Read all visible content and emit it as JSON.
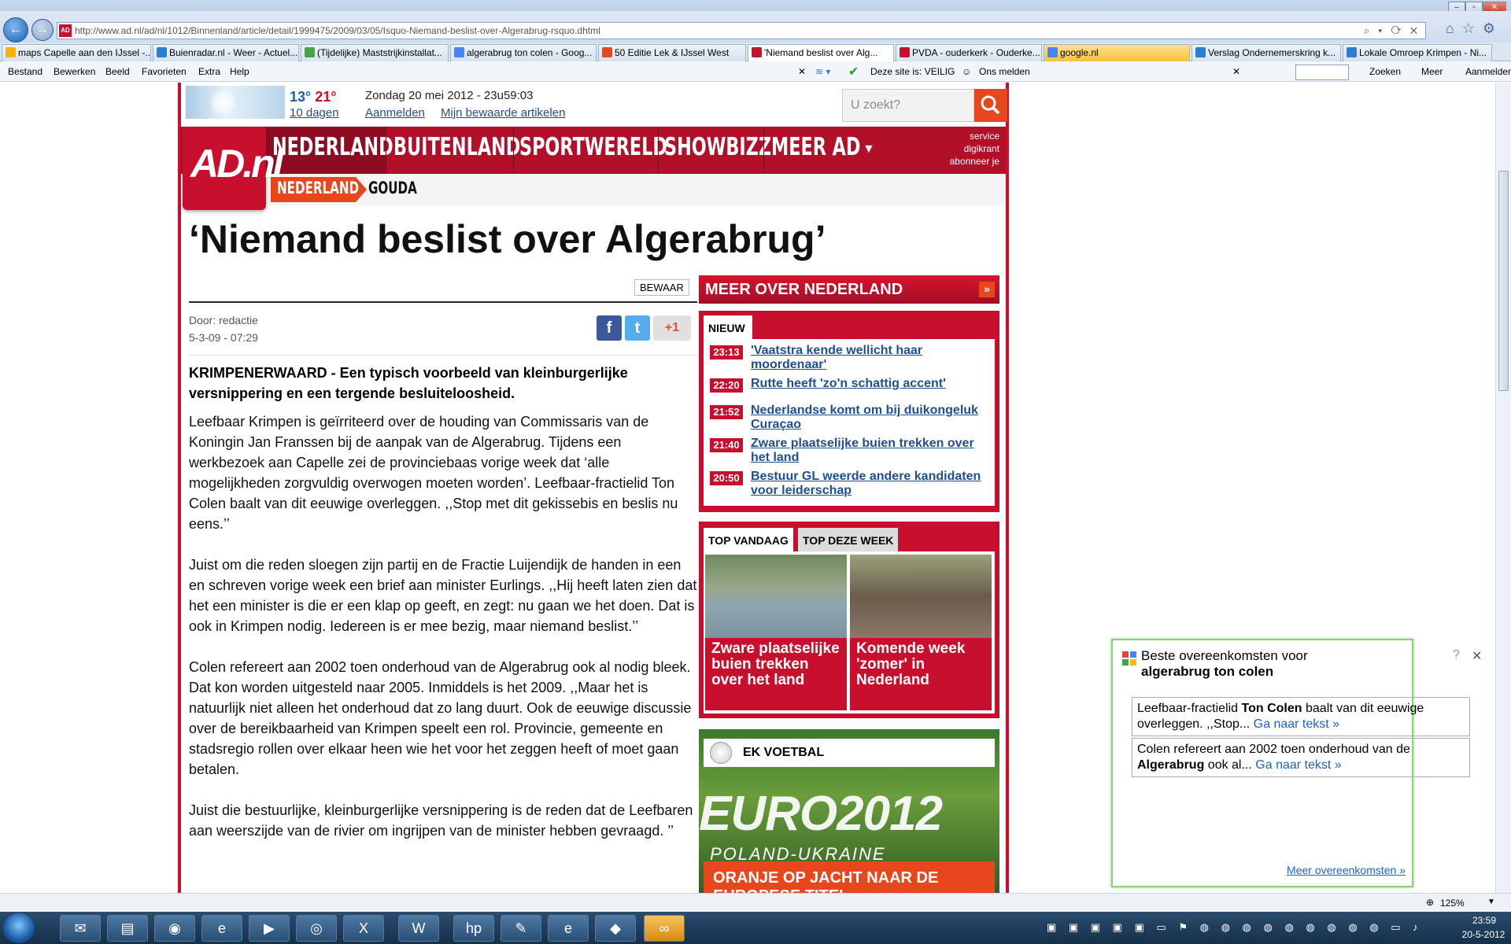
{
  "browser": {
    "url": "http://www.ad.nl/ad/nl/1012/Binnenland/article/detail/1999475/2009/03/05/Isquo-Niemand-beslist-over-Algerabrug-rsquo.dhtml",
    "tabs": [
      {
        "label": "maps Capelle aan den IJssel -...",
        "color": "#f4b400"
      },
      {
        "label": "Buienradar.nl - Weer - Actuel...",
        "color": "#2a7fd4"
      },
      {
        "label": "(Tijdelijke) Maststrijkinstallat...",
        "color": "#4aa34a"
      },
      {
        "label": "algerabrug ton colen - Goog...",
        "color": "#4285f4"
      },
      {
        "label": "50 Editie Lek & IJssel West",
        "color": "#e8461c"
      },
      {
        "label": "'Niemand beslist over Alg...",
        "color": "#c8102e"
      },
      {
        "label": "PVDA - ouderkerk - Ouderke...",
        "color": "#c8102e"
      },
      {
        "label": "google.nl",
        "color": "#4285f4"
      },
      {
        "label": "Verslag Ondernemerskring k...",
        "color": "#2a7fd4"
      },
      {
        "label": "Lokale Omroep Krimpen - Ni...",
        "color": "#2a7fd4"
      }
    ],
    "menu": [
      "Bestand",
      "Bewerken",
      "Beeld",
      "Favorieten",
      "Extra",
      "Help"
    ],
    "safe_site": "Deze site is: VEILIG",
    "report": "Ons melden",
    "google_search": "Zoeken",
    "more": "Meer",
    "login": "Aanmelden",
    "zoom": "125%"
  },
  "site": {
    "weather": {
      "min": "13°",
      "max": "21°",
      "days": "10 dagen"
    },
    "date": "Zondag 20 mei 2012 - 23u59:03",
    "login": "Aanmelden",
    "saved_articles": "Mijn bewaarde artikelen",
    "search_placeholder": "U zoekt?",
    "logo": "AD.nl",
    "nav": [
      "NEDERLAND",
      "BUITENLAND",
      "SPORTWERELD",
      "SHOWBIZZ",
      "MEER AD"
    ],
    "service": [
      "service",
      "digikrant",
      "abonneer je"
    ],
    "subnav": [
      "NEDERLAND",
      "GOUDA"
    ]
  },
  "article": {
    "title": "‘Niemand beslist over Algerabrug’",
    "save": "BEWAAR",
    "author": "Door: redactie",
    "date": "5-3-09 - 07:29",
    "share": {
      "facebook": "f",
      "twitter": "t",
      "gplus": "+1"
    },
    "lead": "KRIMPENERWAARD - Een typisch voorbeeld van kleinburgerlijke versnippering en een tergende besluiteloosheid.",
    "paragraphs": [
      "Leefbaar Krimpen is geïrriteerd over de houding van Commissaris van de Koningin Jan Franssen bij de aanpak van de Algerabrug. Tijdens een werkbezoek aan Capelle zei de provinciebaas vorige week dat ‘alle mogelijkheden zorgvuldig overwogen moeten worden’. Leefbaar-fractielid Ton Colen baalt van dit eeuwige overleggen. ,,Stop met dit gekissebis en beslis nu eens.’’",
      "Juist om die reden sloegen zijn partij en de Fractie Luijendijk de handen in een en schreven vorige week een brief aan minister Eurlings. ,,Hij heeft laten zien dat het een minister is die er een klap op geeft, en zegt: nu gaan we het doen. Dat is ook in Krimpen nodig. Iedereen is er mee bezig, maar niemand beslist.’’",
      "Colen refereert aan 2002 toen onderhoud van de Algerabrug ook al nodig bleek. Dat kon worden uitgesteld naar 2005. Inmiddels is het 2009. ,,Maar het is natuurlijk niet alleen het onderhoud dat zo lang duurt. Ook de eeuwige discussie over de bereikbaarheid van Krimpen speelt een rol. Provincie, gemeente en stadsregio rollen over elkaar heen wie het voor het zeggen heeft of moet gaan betalen.",
      "Juist die bestuurlijke, kleinburgerlijke versnippering is de reden dat de Leefbaren aan weerszijde van de rivier om ingrijpen van de minister hebben gevraagd. ’’"
    ]
  },
  "sidebar": {
    "more_title": "MEER OVER NEDERLAND",
    "new_tab": "NIEUW",
    "news": [
      {
        "time": "23:13",
        "title": "'Vaatstra kende wellicht haar moordenaar'"
      },
      {
        "time": "22:20",
        "title": "Rutte heeft 'zo'n schattig accent'"
      },
      {
        "time": "21:52",
        "title": "Nederlandse komt om bij duikongeluk Curaçao"
      },
      {
        "time": "21:40",
        "title": "Zware plaatselijke buien trekken over het land"
      },
      {
        "time": "20:50",
        "title": "Bestuur GL weerde andere kandidaten voor leiderschap"
      }
    ],
    "top_tabs": [
      "TOP VANDAAG",
      "TOP DEZE WEEK"
    ],
    "top_items": [
      {
        "caption": "Zware plaatselijke buien trekken over het land"
      },
      {
        "caption": "Komende week 'zomer' in Nederland"
      }
    ],
    "ek_title": "EK VOETBAL",
    "ek_logo": "EURO2012",
    "ek_sub": "POLAND-UKRAINE",
    "ek_promo": "ORANJE OP JACHT NAAR DE EUROPESE TITEL »"
  },
  "popup": {
    "title_prefix": "Beste overeenkomsten voor",
    "title_query": "algerabrug ton colen",
    "help": "?",
    "close": "✕",
    "results": [
      {
        "pre": "Leefbaar-fractielid ",
        "bold": "Ton Colen",
        "post": " baalt van dit eeuwige overleggen. ,,Stop...",
        "link": "Ga naar tekst »"
      },
      {
        "pre": "Colen refereert aan 2002 toen onderhoud van de ",
        "bold": "Algerabrug",
        "post": " ook al...",
        "link": "Ga naar tekst »"
      }
    ],
    "more": "Meer overeenkomsten »"
  },
  "taskbar": {
    "time": "23:59",
    "date": "20-5-2012"
  }
}
